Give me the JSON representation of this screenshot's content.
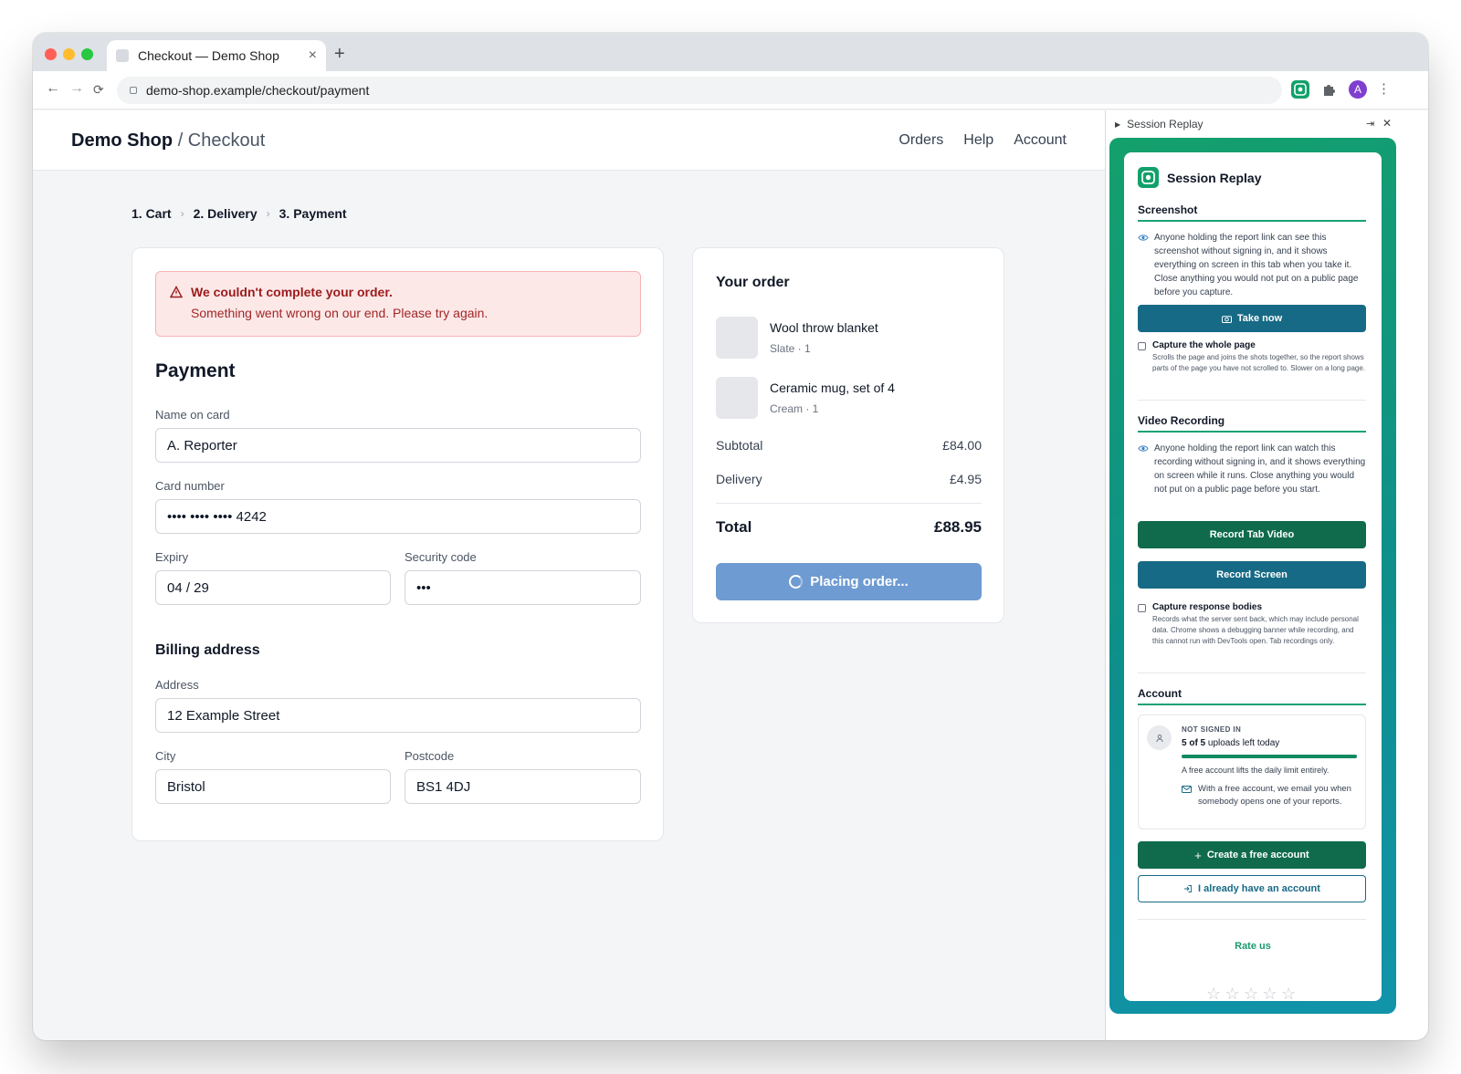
{
  "browser": {
    "tab_title": "Checkout — Demo Shop",
    "tab_close": "×",
    "new_tab": "+",
    "url": "demo-shop.example/checkout/payment",
    "back": "←",
    "forward": "→",
    "reload": "⟳",
    "profile_initial": "A",
    "menu": "⋮"
  },
  "header": {
    "brand": "Demo Shop",
    "brand_sub": "/ Checkout",
    "links": [
      "Orders",
      "Help",
      "Account"
    ]
  },
  "breadcrumb": {
    "steps": [
      "1. Cart",
      "2. Delivery",
      "3. Payment"
    ],
    "sep": "›"
  },
  "alert": {
    "title": "We couldn't complete your order.",
    "message": "Something went wrong on our end. Please try again.",
    "color": "#9b1c1c"
  },
  "payment": {
    "heading": "Payment",
    "name_label": "Name on card",
    "name_value": "A. Reporter",
    "card_label": "Card number",
    "card_value": "•••• •••• •••• 4242",
    "expiry_label": "Expiry",
    "expiry_value": "04 / 29",
    "cvc_label": "Security code",
    "cvc_value": "•••"
  },
  "billing": {
    "heading": "Billing address",
    "address_label": "Address",
    "address_value": "12 Example Street",
    "city_label": "City",
    "city_value": "Bristol",
    "postcode_label": "Postcode",
    "postcode_value": "BS1 4DJ"
  },
  "order": {
    "heading": "Your order",
    "items": [
      {
        "name": "Wool throw blanket",
        "meta": "Slate · 1"
      },
      {
        "name": "Ceramic mug, set of 4",
        "meta": "Cream · 1"
      }
    ],
    "subtotal_label": "Subtotal",
    "subtotal": "£84.00",
    "delivery_label": "Delivery",
    "delivery": "£4.95",
    "total_label": "Total",
    "total": "£88.95",
    "button": "Placing order...",
    "button_color": "#6e9bd1"
  },
  "panel": {
    "header": "Session Replay",
    "header_arrow": "▶",
    "pin": "⇥",
    "close": "✕",
    "title": "Session Replay",
    "screenshot": {
      "heading": "Screenshot",
      "notice": "Anyone holding the report link can see this screenshot without signing in, and it shows everything on screen in this tab when you take it. Close anything you would not put on a public page before you capture.",
      "button": "Take now",
      "checkbox_label": "Capture the whole page",
      "checkbox_help": "Scrolls the page and joins the shots together, so the report shows parts of the page you have not scrolled to. Slower on a long page."
    },
    "video": {
      "heading": "Video Recording",
      "notice": "Anyone holding the report link can watch this recording without signing in, and it shows everything on screen while it runs. Close anything you would not put on a public page before you start.",
      "record_tab": "Record Tab Video",
      "record_screen": "Record Screen",
      "checkbox_label": "Capture response bodies",
      "checkbox_help": "Records what the server sent back, which may include personal data. Chrome shows a debugging banner while recording, and this cannot run with DevTools open. Tab recordings only."
    },
    "account": {
      "heading": "Account",
      "status": "NOT SIGNED IN",
      "uploads_bold": "5 of 5",
      "uploads_rest": " uploads left today",
      "uploads_fraction": 1.0,
      "free_note": "A free account lifts the daily limit entirely.",
      "email_note": "With a free account, we email you when somebody opens one of your reports.",
      "create": "Create a free account",
      "signin": "I already have an account"
    },
    "rate_label": "Rate us",
    "rating_stars": 5,
    "star_glyph": "☆",
    "accent": "#1aa176",
    "dark_green": "#0f6b4c",
    "dark_teal": "#176a85"
  }
}
